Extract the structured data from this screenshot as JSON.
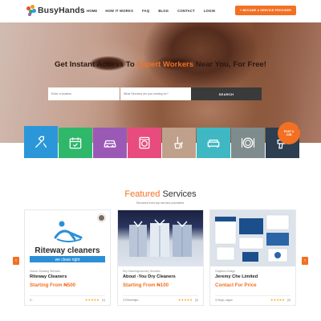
{
  "brand": {
    "name": "BusyHands"
  },
  "nav": {
    "items": [
      "HOME",
      "HOW IT WORKS",
      "FAQ",
      "BLOG",
      "CONTACT",
      "LOGIN"
    ],
    "cta": "+ BECOME A SERVICE PROVIDER"
  },
  "hero": {
    "title_pre": "Get Instant Access To ",
    "title_highlight": "Expert Workers",
    "title_post": " Near You, For Free!",
    "location_placeholder": "Enter a location",
    "service_placeholder": "What Services are you looking for?",
    "search_button": "SEARCH"
  },
  "categories": [
    {
      "icon": "tools-icon",
      "color": "#2b97d8"
    },
    {
      "icon": "calendar-icon",
      "color": "#2fb86a"
    },
    {
      "icon": "car-icon",
      "color": "#9b59b6"
    },
    {
      "icon": "washing-machine-icon",
      "color": "#e74c7c"
    },
    {
      "icon": "cleaning-icon",
      "color": "#bfa08a"
    },
    {
      "icon": "sofa-icon",
      "color": "#3fb8c4"
    },
    {
      "icon": "plate-icon",
      "color": "#7f8c8d"
    },
    {
      "icon": "drill-icon",
      "color": "#2c3e50"
    }
  ],
  "post_job": {
    "line1": "POST A",
    "line2": "JOB"
  },
  "featured": {
    "title_a": "Featured",
    "title_b": " Services",
    "subtitle": "Services from top service providers."
  },
  "cards": [
    {
      "category": "House Cleaning Services",
      "name": "Riteway Cleaners",
      "price": "Starting From ₦500",
      "location": "⚲ ..",
      "stars": "★★★★★",
      "count": "(1)",
      "logo_text": "Riteway cleaners",
      "logo_sub": "we clean right"
    },
    {
      "category": "Dry Cleaning/Laundry Services",
      "name": "About -You Dry Cleaners",
      "price": "Starting From ₦100",
      "location": "⚲ Eleventips..",
      "stars": "★★★★★",
      "count": "(2)"
    },
    {
      "category": "Graphics Design",
      "name": "Jeremy Che Limited",
      "price": "Contact For Price",
      "location": "⚲ Ikeja, Lagos",
      "stars": "★★★★★",
      "count": "(0)"
    }
  ]
}
